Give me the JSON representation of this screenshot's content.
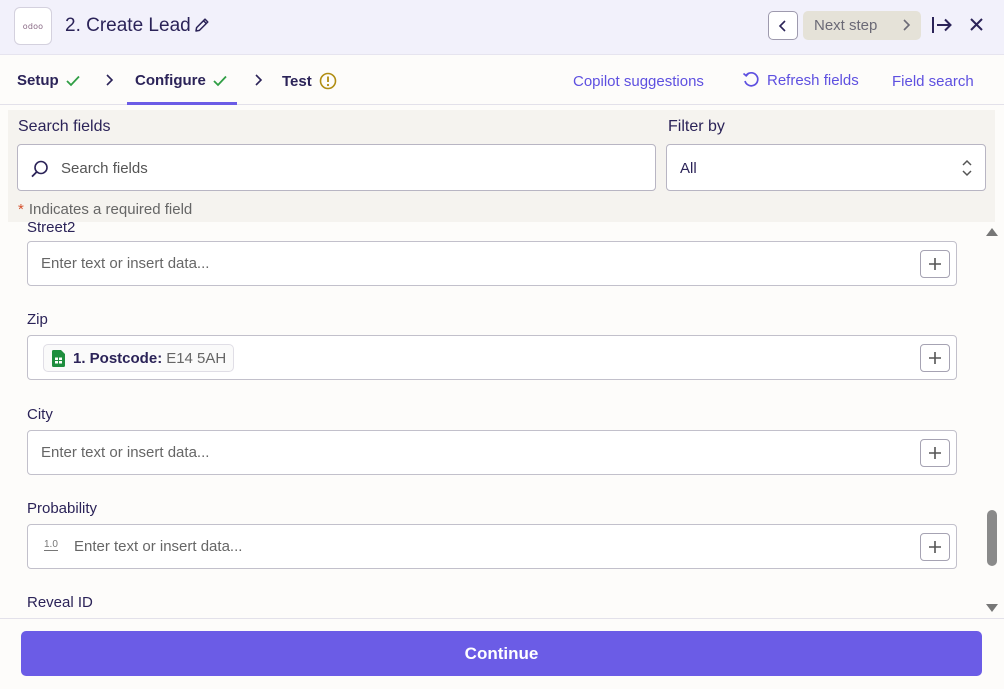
{
  "header": {
    "app_logo_text": "odoo",
    "step_title": "2. Create Lead",
    "next_step_label": "Next step"
  },
  "tabs": [
    {
      "label": "Setup",
      "status": "complete"
    },
    {
      "label": "Configure",
      "status": "complete"
    },
    {
      "label": "Test",
      "status": "warning"
    }
  ],
  "actions": {
    "copilot": "Copilot suggestions",
    "refresh": "Refresh fields",
    "field_search": "Field search"
  },
  "search": {
    "label": "Search fields",
    "placeholder": "Search fields",
    "filter_label": "Filter by",
    "filter_value": "All",
    "required_note": "Indicates a required field"
  },
  "fields": {
    "street2": {
      "label": "Street2",
      "placeholder": "Enter text or insert data..."
    },
    "zip": {
      "label": "Zip",
      "pill_name": "1. Postcode:",
      "pill_value": "E14 5AH"
    },
    "city": {
      "label": "City",
      "placeholder": "Enter text or insert data..."
    },
    "probability": {
      "label": "Probability",
      "placeholder": "Enter text or insert data...",
      "type_hint": "1.0"
    },
    "reveal_id": {
      "label": "Reveal ID"
    }
  },
  "footer": {
    "continue_label": "Continue"
  },
  "colors": {
    "accent": "#6b5ce6",
    "success": "#2f9e44",
    "warning": "#b08d12",
    "sheets_green": "#1e8e3e"
  }
}
